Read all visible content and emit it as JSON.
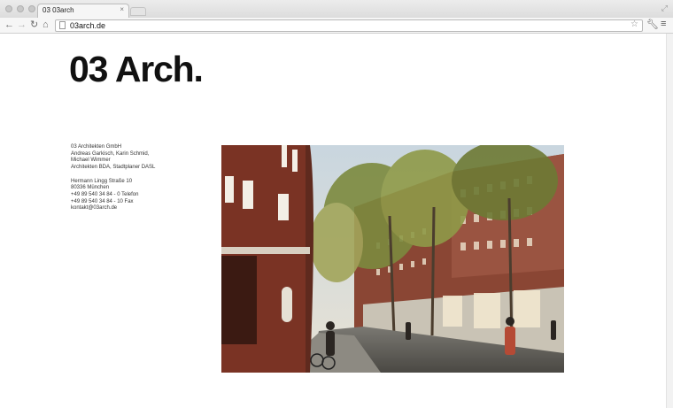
{
  "browser": {
    "tab_title": "03 03arch",
    "tab_close": "×",
    "url": "03arch.de"
  },
  "icons": {
    "back": "back-arrow-icon",
    "forward": "forward-arrow-icon",
    "reload": "reload-icon",
    "home": "home-icon",
    "page": "page-icon",
    "bookmark": "star-icon",
    "wrench": "wrench-icon",
    "menu": "menu-icon",
    "fullscreen": "fullscreen-icon"
  },
  "page": {
    "logo": "03 Arch.",
    "address": {
      "company": "03 Architekten GmbH",
      "partners_1": "Andreas Garkisch, Karin Schmid,",
      "partners_2": "Michael Wimmer",
      "credentials": "Architekten BDA, Stadtplaner DASL",
      "street": "Hermann Lingg Straße 10",
      "city": "80336 München",
      "phone": "+49 89 540 34 84 - 0 Telefon",
      "fax": "+49 89 540 34 84 - 10 Fax",
      "email": "kontakt@03arch.de"
    },
    "photo_label": "street-rendering-photo"
  },
  "colors": {
    "logo": "#111111",
    "brick": "#7a3324"
  }
}
